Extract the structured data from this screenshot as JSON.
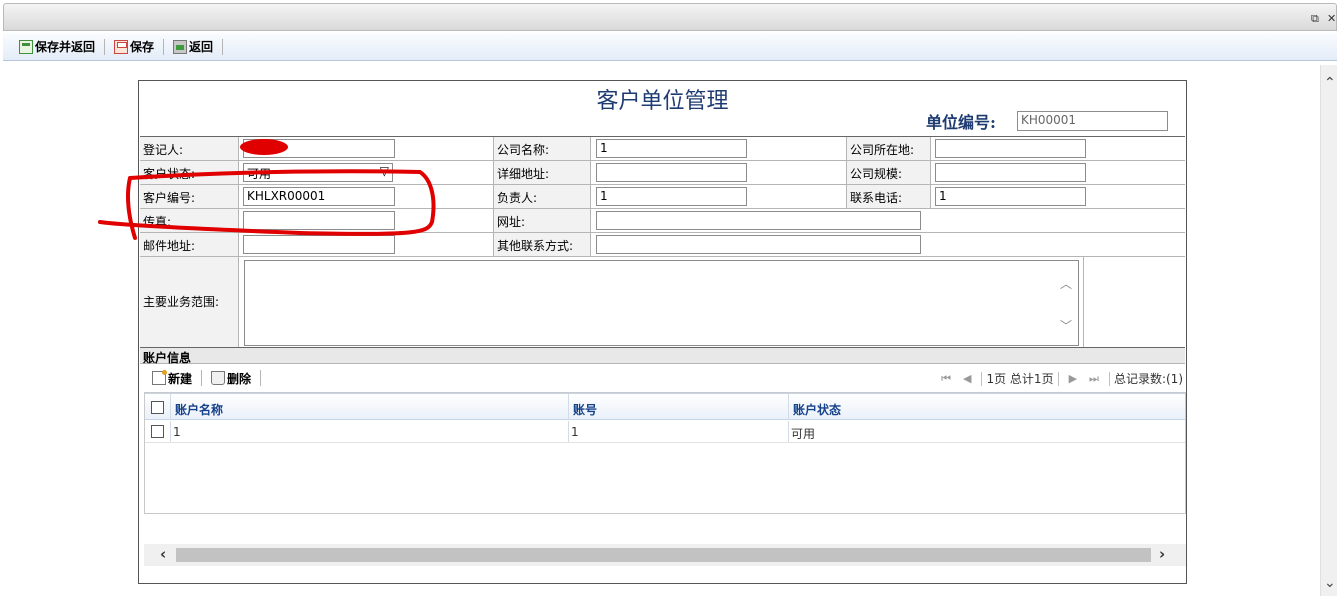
{
  "window": {
    "restore_glyph": "⧉",
    "close_glyph": "✕"
  },
  "toolbar": {
    "save_and_return": "保存并返回",
    "save": "保存",
    "return": "返回"
  },
  "form": {
    "title": "客户单位管理",
    "unit_no_label": "单位编号:",
    "unit_no_value": "KH00001",
    "fields": {
      "registrant_label": "登记人:",
      "registrant_value": "",
      "company_name_label": "公司名称:",
      "company_name_value": "1",
      "company_location_label": "公司所在地:",
      "company_location_value": "",
      "customer_status_label": "客户状态:",
      "customer_status_value": "可用",
      "detail_address_label": "详细地址:",
      "detail_address_value": "",
      "company_scale_label": "公司规模:",
      "company_scale_value": "",
      "customer_no_label": "客户编号:",
      "customer_no_value": "KHLXR00001",
      "person_in_charge_label": "负责人:",
      "person_in_charge_value": "1",
      "phone_label": "联系电话:",
      "phone_value": "1",
      "fax_label": "传真:",
      "fax_value": "",
      "website_label": "网址:",
      "website_value": "",
      "email_label": "邮件地址:",
      "email_value": "",
      "other_contact_label": "其他联系方式:",
      "other_contact_value": "",
      "business_scope_label": "主要业务范围:",
      "business_scope_value": ""
    }
  },
  "account": {
    "section_title": "账户信息",
    "new_label": "新建",
    "delete_label": "删除",
    "pager": {
      "page_text": "1页 总计1页",
      "total_text": "总记录数:(1)"
    },
    "columns": [
      "账户名称",
      "账号",
      "账户状态"
    ],
    "rows": [
      [
        "1",
        "1",
        "可用"
      ]
    ]
  },
  "colors": {
    "title": "#1e3c72",
    "header_text": "#15428b",
    "annotation": "#e00000"
  }
}
